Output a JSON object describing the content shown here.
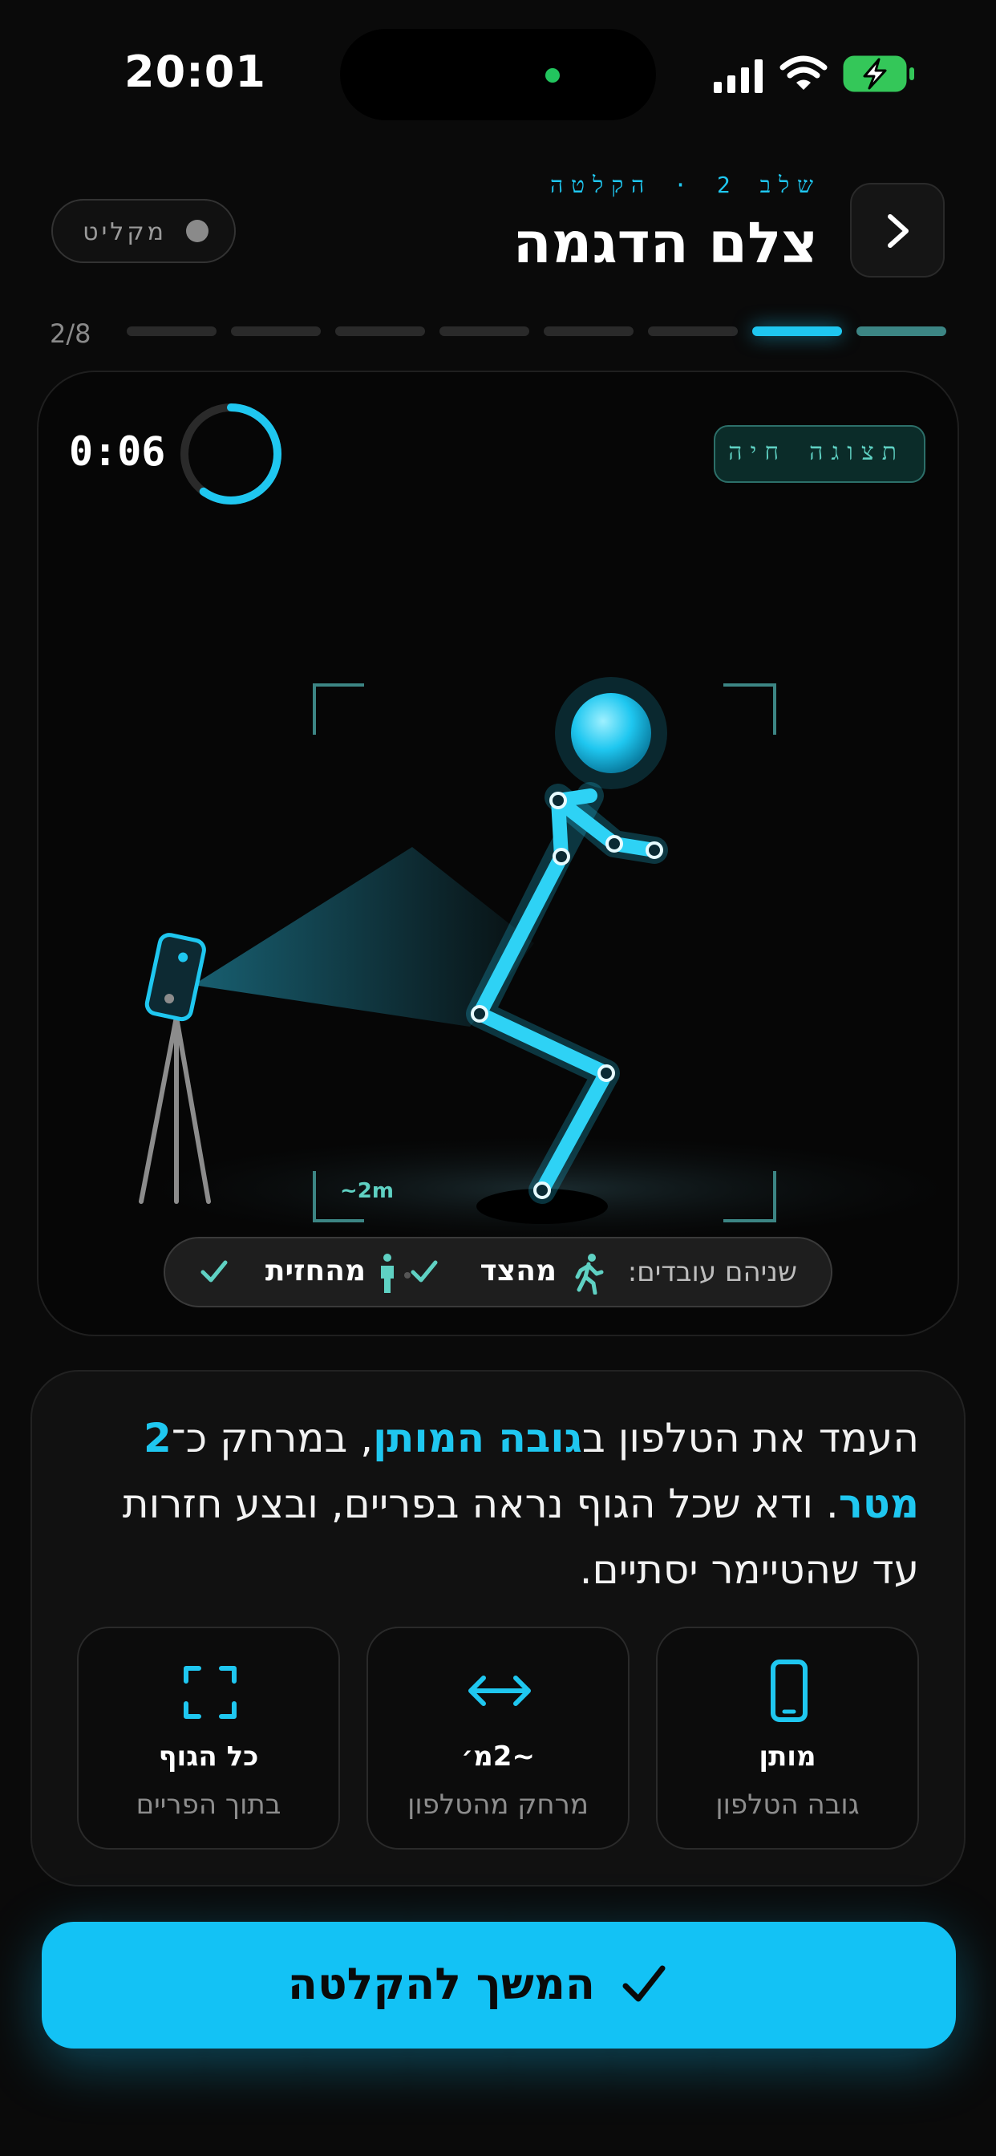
{
  "status_bar": {
    "time": "20:01"
  },
  "header": {
    "step_label": "שלב 2 · הקלטה",
    "title": "צלם הדגמה",
    "recording_label": "מקליט",
    "back_icon": "chevron-right-icon"
  },
  "progress": {
    "counter": "2/8",
    "current_step": 2,
    "total_steps": 8
  },
  "preview": {
    "timer": "0:06",
    "timer_fraction": 0.6,
    "live_label": "תצוגה חיה",
    "distance_label": "~2m",
    "views": {
      "label": "שניהם עובדים:",
      "side": "מהצד",
      "front": "מהחזית"
    }
  },
  "instructions": {
    "text_prefix": "העמד את הטלפון ב",
    "highlight_1": "גובה המותן",
    "text_mid": ", במרחק כ־",
    "highlight_2": "2 מטר",
    "text_suffix": ". ודא שכל הגוף נראה בפריים, ובצע חזרות עד שהטיימר יסתיים."
  },
  "tiles": [
    {
      "icon": "phone-icon",
      "value": "מותן",
      "caption": "גובה הטלפון"
    },
    {
      "icon": "arrows-horizontal-icon",
      "value": "~2מ׳",
      "caption": "מרחק מהטלפון"
    },
    {
      "icon": "frame-corners-icon",
      "value": "כל הגוף",
      "caption": "בתוך הפריים"
    }
  ],
  "cta": {
    "label": "המשך להקלטה",
    "icon": "check-icon"
  },
  "colors": {
    "accent": "#1FC7F0",
    "background": "#0A0A0A",
    "teal": "#5FD1C3"
  }
}
